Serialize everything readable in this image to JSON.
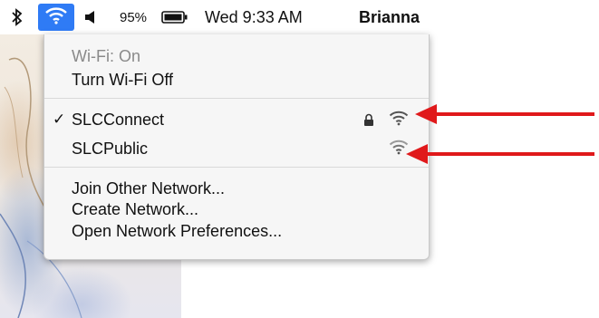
{
  "menubar": {
    "bluetooth_icon": "bluetooth-icon",
    "wifi_icon": "wifi-icon",
    "volume_icon": "volume-icon",
    "battery_percent": "95%",
    "battery_icon": "battery-icon",
    "clock": "Wed 9:33 AM",
    "user": "Brianna"
  },
  "wifi_menu": {
    "status": "Wi-Fi: On",
    "toggle_label": "Turn Wi-Fi Off",
    "networks": [
      {
        "name": "SLCConnect",
        "connected": true,
        "secured": true,
        "check": "✓"
      },
      {
        "name": "SLCPublic",
        "connected": false,
        "secured": false
      }
    ],
    "join_other": "Join Other Network...",
    "create_network": "Create Network...",
    "open_prefs": "Open Network Preferences..."
  },
  "colors": {
    "accent": "#2f7bf5",
    "arrow": "#e0191b"
  }
}
